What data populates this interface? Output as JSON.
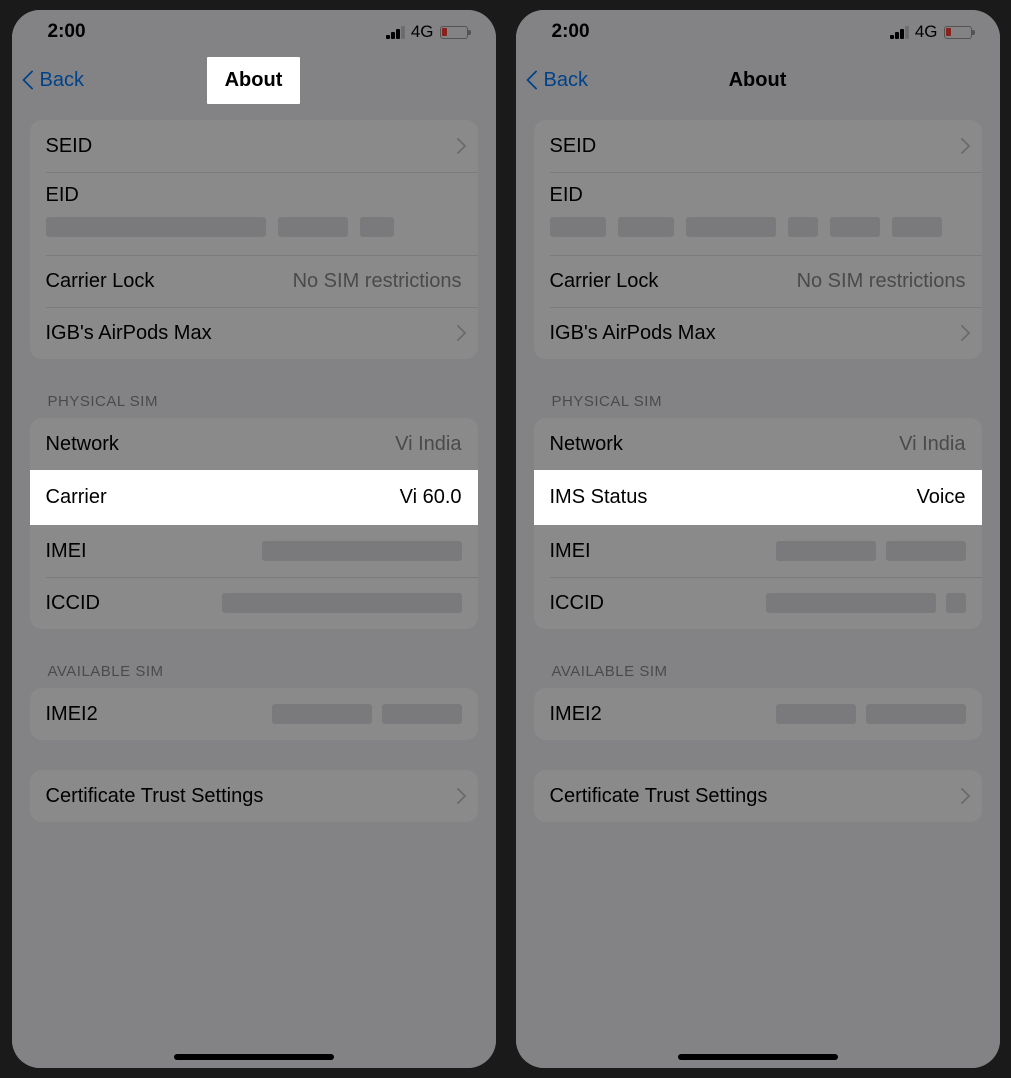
{
  "status": {
    "time": "2:00",
    "network_type": "4G"
  },
  "nav": {
    "back_label": "Back",
    "title": "About"
  },
  "rows": {
    "seid": "SEID",
    "eid": "EID",
    "carrier_lock": "Carrier Lock",
    "carrier_lock_val": "No SIM restrictions",
    "airpods": "IGB's AirPods Max",
    "network": "Network",
    "network_val": "Vi India",
    "carrier": "Carrier",
    "carrier_val": "Vi 60.0",
    "ims_status": "IMS Status",
    "ims_status_val": "Voice",
    "imei": "IMEI",
    "iccid": "ICCID",
    "imei2": "IMEI2",
    "cert_trust": "Certificate Trust Settings"
  },
  "headers": {
    "physical_sim": "PHYSICAL SIM",
    "available_sim": "AVAILABLE SIM"
  }
}
